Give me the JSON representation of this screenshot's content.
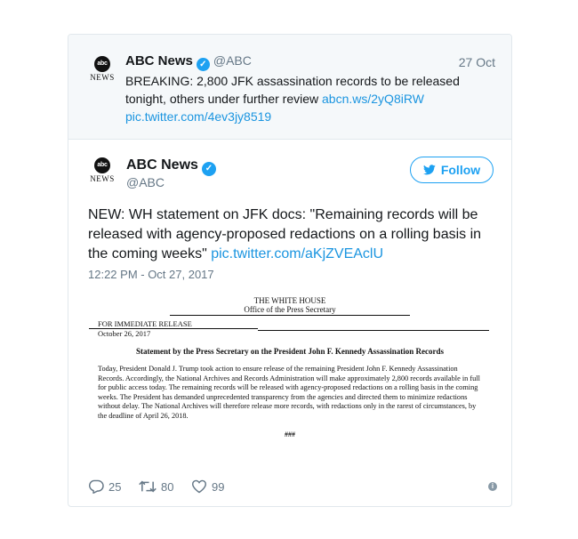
{
  "quoted": {
    "logo": {
      "globe_text": "abc",
      "news_text": "NEWS"
    },
    "name": "ABC News",
    "handle": "@ABC",
    "date": "27 Oct",
    "text": "BREAKING: 2,800 JFK assassination records to be released tonight, others under further review",
    "link1": "abcn.ws/2yQ8iRW",
    "link2": "pic.twitter.com/4ev3jy8519"
  },
  "tweet": {
    "logo": {
      "globe_text": "abc",
      "news_text": "NEWS"
    },
    "name": "ABC News",
    "handle": "@ABC",
    "follow_label": "Follow",
    "text": "NEW: WH statement on JFK docs: \"Remaining records will be released with agency-proposed redactions on a rolling basis in the coming weeks\"",
    "link": "pic.twitter.com/aKjZVEAclU",
    "timestamp": "12:22 PM - Oct 27, 2017"
  },
  "document": {
    "header_line1": "THE WHITE HOUSE",
    "header_line2": "Office of the Press Secretary",
    "release_label": "FOR IMMEDIATE RELEASE",
    "date": "October 26, 2017",
    "title": "Statement by the Press Secretary on the President John F. Kennedy Assassination Records",
    "body": "Today, President Donald J. Trump took action to ensure release of the remaining President John F. Kennedy Assassination Records.  Accordingly, the National Archives and Records Administration will make approximately 2,800 records available in full for public access today.  The remaining records will be released with agency-proposed redactions on a rolling basis in the coming weeks.  The President has demanded unprecedented transparency from the agencies and directed them to minimize redactions without delay.  The National Archives will therefore release more records, with redactions only in the rarest of circumstances, by the deadline of April 26, 2018.",
    "end_mark": "###"
  },
  "actions": {
    "replies": "25",
    "retweets": "80",
    "likes": "99"
  },
  "colors": {
    "accent": "#1da1f2",
    "link": "#1b95e0",
    "muted": "#657786",
    "quoted_bg": "#f5f8fa",
    "border": "#e1e8ed"
  },
  "icons": [
    "verified-badge-icon",
    "twitter-bird-icon",
    "reply-icon",
    "retweet-icon",
    "like-heart-icon",
    "info-icon"
  ]
}
